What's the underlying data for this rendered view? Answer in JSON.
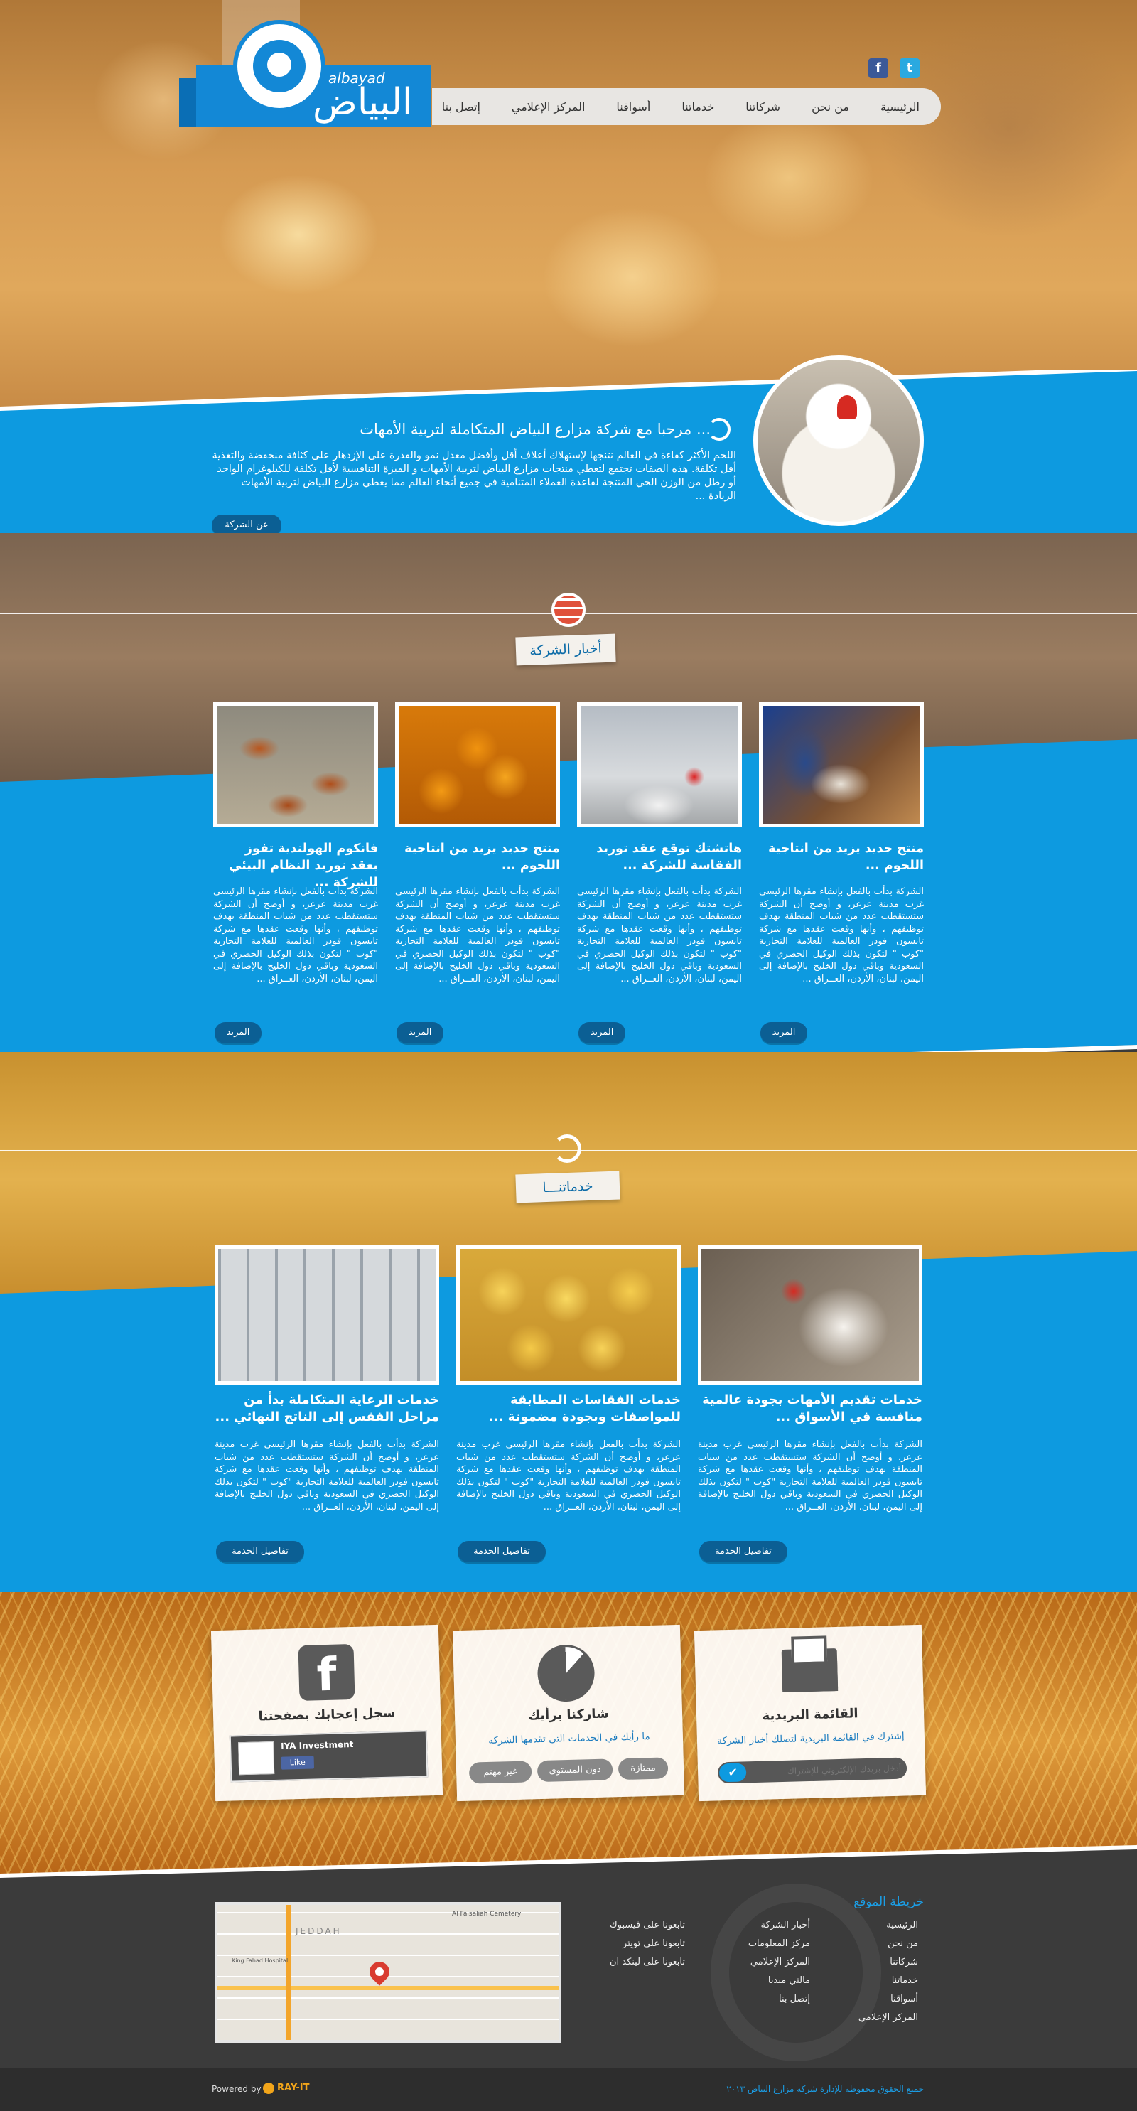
{
  "header": {
    "logo_en": "albayad",
    "logo_ar": "البياض",
    "social": [
      "f",
      "t"
    ],
    "nav": [
      "الرئيسية",
      "من نحن",
      "شركاتنا",
      "خدماتنا",
      "أسواقنا",
      "المركز الإعلامي",
      "إتصل بنا"
    ]
  },
  "welcome": {
    "title": "مرحبا مع شركة مزارع البياض المتكاملة لتربية الأمهات ...",
    "text": "اللحم الأكثر كفاءة في العالم نتنجها لإستهلاك أعلاف أقل وأفضل معدل نمو والقدرة على الإزدهار على كثافة منخفضة والتغذية أقل تكلفة. هذه الصفات تجتمع لتعطي منتجات مزارع البياض لتربية الأمهات و الميزة التنافسية لأقل تكلفة للكيلوغرام الواحد أو رطل من الوزن الحي المنتجة لقاعدة العملاء المتنامية في جميع أنحاء العالم مما يعطي مزارع البياض لتربية الأمهات الريادة ...",
    "button": "عن الشركة"
  },
  "news": {
    "title": "أخبار الشركة",
    "more": "المزيد",
    "body": "الشركة بدأت بالفعل بإنشاء مقرها الرئيسي غرب مدينة عرعر، و أوضح أن الشركة ستستقطب عدد من شباب المنطقة بهدف توظيفهم ، وأنها وقعت عقدها مع شركة تايسون فودز العالمية للعلامة التجارية \"كوب \" لتكون بذلك الوكيل الحصري في السعودية وباقي دول الخليج بالإضافة إلى اليمن، لبنان، الأردن، العــراق ...",
    "items": [
      {
        "title": "منتج جديد يزيد من انتاجية اللحوم ..."
      },
      {
        "title": "هاتشتك توقع عقد توريد الفقاسة للشركة ..."
      },
      {
        "title": "منتج جديد يزيد من انتاجية اللحوم ..."
      },
      {
        "title": "فانكوم الهولندية تفوز بعقد توريد النظام البيئي للشركة ..."
      }
    ]
  },
  "services": {
    "title": "خدماتنـــا",
    "details": "تفاصيل الخدمة",
    "body": "الشركة بدأت بالفعل بإنشاء مقرها الرئيسي غرب مدينة عرعر، و أوضح أن الشركة ستستقطب عدد من شباب المنطقة بهدف توظيفهم ، وأنها وقعت عقدها مع شركة تايسون فودز العالمية للعلامة التجارية \"كوب \" لتكون بذلك الوكيل الحصري في السعودية وباقي دول الخليج بالإضافة إلى اليمن، لبنان، الأردن، العــراق ...",
    "items": [
      {
        "title": "خدمات تقديم الأمهات بجودة عالمية منافسة في الأسواق ..."
      },
      {
        "title": "خدمات الفقاسات المطابقة للمواصفات وبجودة مضمونة ..."
      },
      {
        "title": "خدمات الرعاية المتكاملة بدأ من مراحل الفقس إلى الناتج النهائي ..."
      }
    ]
  },
  "panels": {
    "newsletter": {
      "title": "القائمة البريدية",
      "sub": "إشترك في القائمة البريدية لتصلك أخبار الشركة",
      "placeholder": "أدخل بريدك الإلكتروني للإشتراك"
    },
    "poll": {
      "title": "شاركنا برأيك",
      "sub": "ما رأيك في الخدمات التي تقدمها الشركة",
      "options": [
        "ممتازة",
        "دون المستوى",
        "غير مهتم"
      ]
    },
    "facebook": {
      "title": "سجل إعجابك بصفحتنا",
      "page_name": "IYA Investment",
      "like": "Like"
    }
  },
  "footer": {
    "sitemap_title": "خريطة الموقع",
    "col1": [
      "الرئيسية",
      "من نحن",
      "شركاتنا",
      "خدماتنا",
      "أسواقنا",
      "المركز الإعلامي"
    ],
    "col2": [
      "أخبار الشركة",
      "مركز المعلومات",
      "المركز الإعلامي",
      "مالتي ميديا",
      "إتصل بنا"
    ],
    "col3": [
      "تابعونا على فيسبوك",
      "تابعونا على تويتر",
      "تابعونا على لينكد ان"
    ],
    "map_labels": [
      "JEDDAH",
      "Al Faisaliah Cemetery",
      "King Fahad Hospital"
    ],
    "powered_by": "Powered by :",
    "powered_brand": "RAY-IT",
    "copyright": "جميع الحقوق محفوظة للإدارة شركة مزارع البياض ٢٠١٣"
  }
}
